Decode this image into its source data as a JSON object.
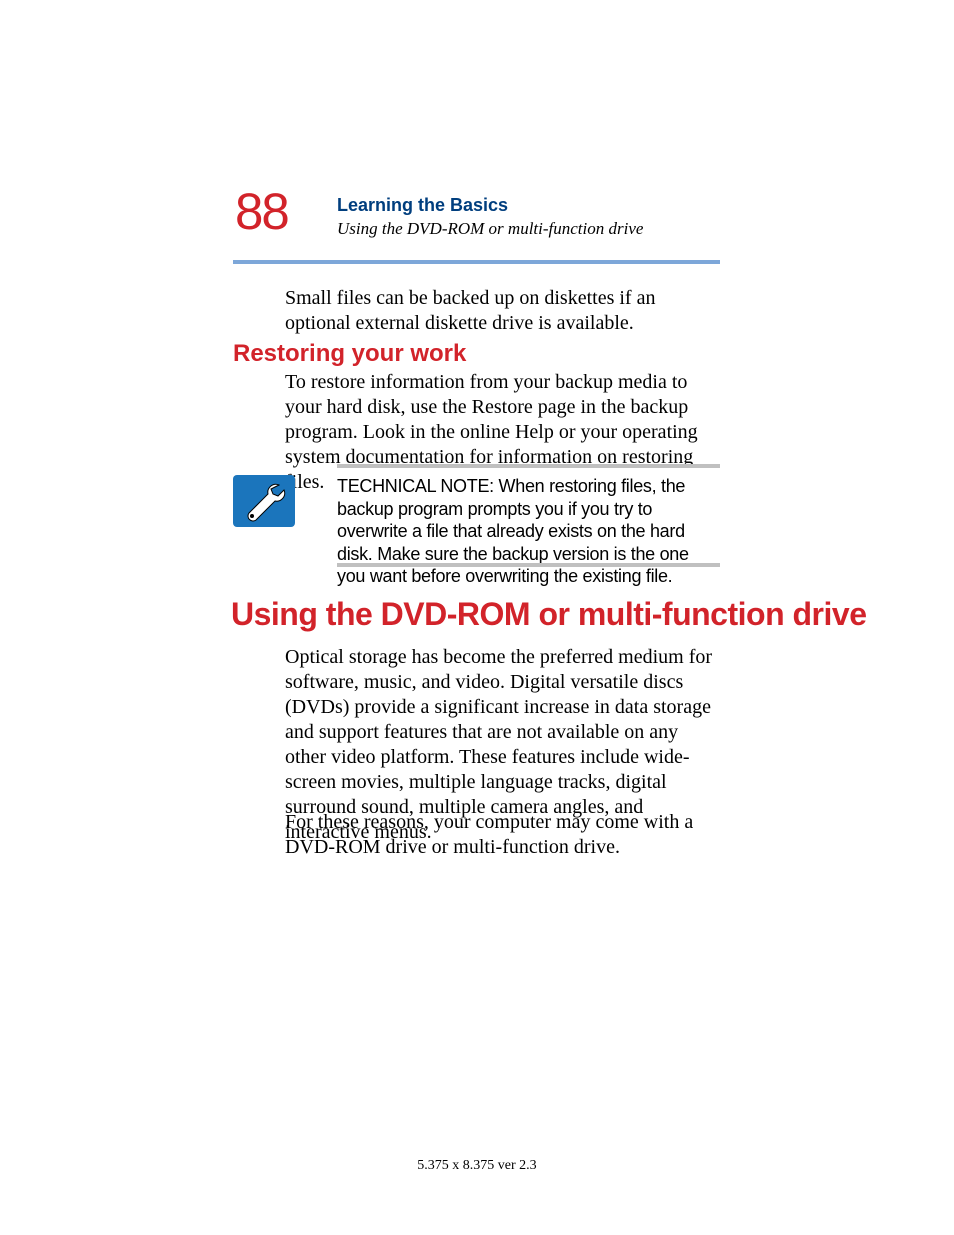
{
  "header": {
    "page_number": "88",
    "chapter": "Learning the Basics",
    "section": "Using the DVD-ROM or multi-function drive"
  },
  "body": {
    "intro": "Small files can be backed up on diskettes if an optional external diskette drive is available.",
    "subheading": "Restoring your work",
    "restore_text": "To restore information from your backup media to your hard disk, use the Restore page in the backup program. Look in the online Help or your operating system documentation for information on restoring files.",
    "technote": "TECHNICAL NOTE: When restoring files, the backup program prompts you if you try to overwrite a file that already exists on the hard disk. Make sure the backup version is the one you want before overwriting the existing file.",
    "heading": "Using the DVD-ROM or multi-function drive",
    "optical_text": "Optical storage has become the preferred medium for software, music, and video. Digital versatile discs (DVDs) provide a significant increase in data storage and support features that are not available on any other video platform. These features include wide-screen movies, multiple language tracks, digital surround sound, multiple camera angles, and interactive menus.",
    "reasons_text": "For these reasons, your computer may come with a DVD-ROM drive or multi-function drive."
  },
  "footer": {
    "text": "5.375 x 8.375 ver 2.3"
  },
  "colors": {
    "accent_red": "#d2232a",
    "accent_blue": "#003e7e",
    "rule_blue": "#7da7d9",
    "rule_gray": "#c0c0c0",
    "icon_bg": "#1b75bc"
  }
}
